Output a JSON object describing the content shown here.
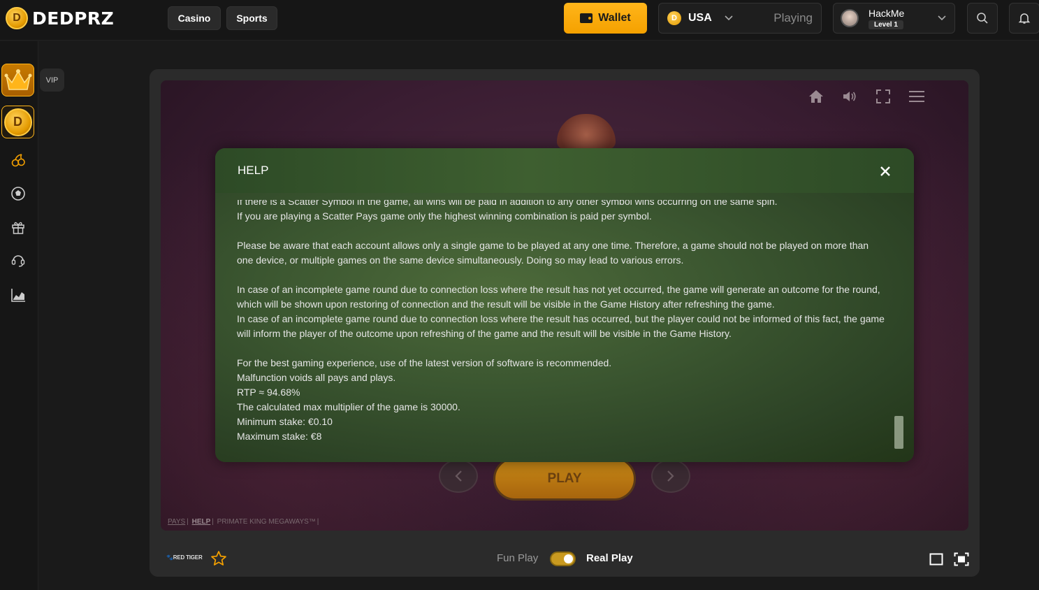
{
  "header": {
    "logo_text": "DEDPRZ",
    "logo_coin_glyph": "D",
    "nav": [
      "Casino",
      "Sports"
    ],
    "wallet_label": "Wallet",
    "currency_label": "USA",
    "status_label": "Playing",
    "username": "HackMe",
    "level": "Level 1"
  },
  "sidebar": {
    "vip_label": "VIP",
    "coin_glyph": "D",
    "icons": [
      "crown-icon",
      "coin-icon",
      "cherries-icon",
      "soccer-ball-icon",
      "gift-icon",
      "support-icon",
      "chart-icon"
    ]
  },
  "game": {
    "play_label": "PLAY",
    "footer_links": [
      "PAYS",
      "HELP",
      "PRIMATE KING MEGAWAYS™"
    ]
  },
  "help": {
    "title": "HELP",
    "paragraphs": [
      "If there is a Scatter Symbol in the game, all wins will be paid in addition to any other symbol wins occurring on the same spin.",
      "If you are playing a Scatter Pays game only the highest winning combination is paid per symbol.",
      "",
      "Please be aware that each account allows only a single game to be played at any one time. Therefore, a game should not be played on more than one device, or multiple games on the same device simultaneously. Doing so may lead to various errors.",
      "",
      "In case of an incomplete game round due to connection loss where the result has not yet occurred, the game will generate an outcome for the round, which will be shown upon restoring of connection and the result will be visible in the Game History after refreshing the game.",
      "In case of an incomplete game round due to connection loss where the result has occurred, but the player could not be informed of this fact, the game will inform the player of the outcome upon refreshing of the game and the result will be visible in the Game History.",
      "",
      "For the best gaming experience, use of the latest version of software is recommended.",
      "Malfunction voids all pays and plays.",
      "RTP ≈ 94.68%",
      "The calculated max multiplier of the game is 30000.",
      "Minimum stake: €0.10",
      "Maximum stake: €8"
    ]
  },
  "frame_bottom": {
    "provider": "RED TIGER",
    "fun_play": "Fun Play",
    "real_play": "Real Play",
    "real_play_enabled": true
  },
  "colors": {
    "accent": "#f5a100",
    "modal_green": "#3b5630",
    "background": "#1a1a1a"
  }
}
